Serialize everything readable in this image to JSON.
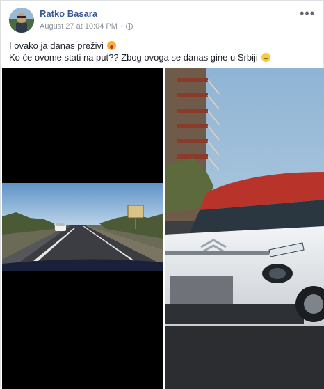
{
  "post": {
    "author": "Ratko Basara",
    "timestamp": "August 27 at 10:04 PM",
    "separator": "·",
    "privacy_icon": "globe-icon",
    "more_icon": "more-options-icon",
    "more_label": "•••",
    "line1": "I ovako ja danas preživi",
    "line2": "Ko će ovome stati na put?? Zbog ovoga se danas gine u Srbiji",
    "emoji1": "shocked-face-icon",
    "emoji2": "pensive-face-icon"
  },
  "colors": {
    "author": "#385898",
    "meta": "#90949c",
    "text": "#1d2129",
    "car_body": "#e8ecef",
    "car_roof": "#c0392b"
  },
  "media": {
    "left_photo": "dashcam-road-photo",
    "right_photo": "white-car-closeup-photo"
  }
}
